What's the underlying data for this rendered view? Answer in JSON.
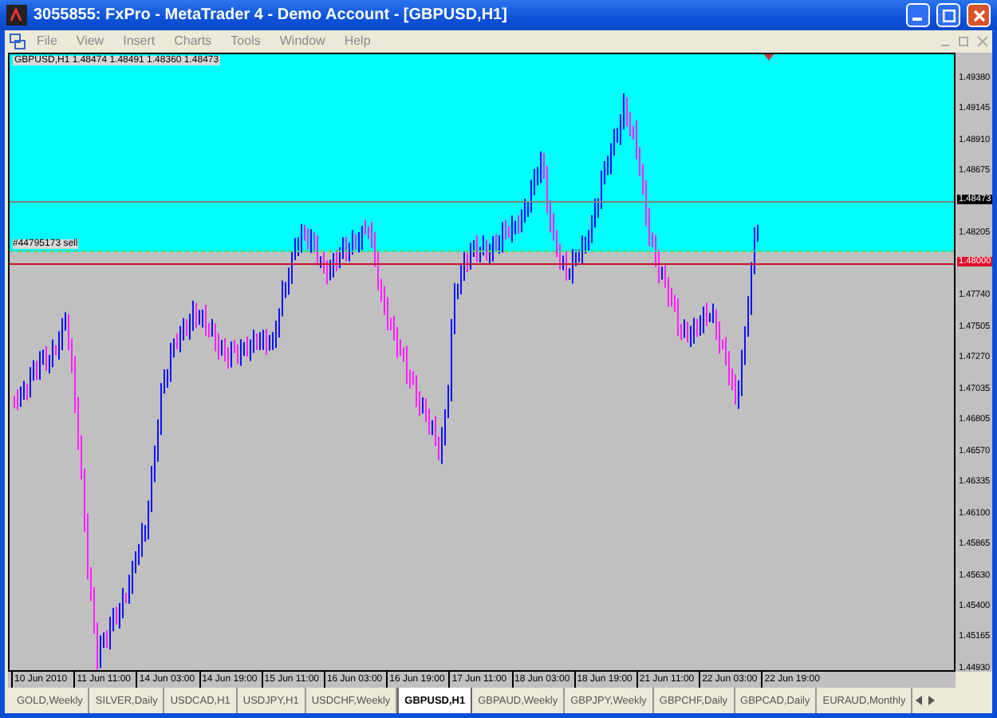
{
  "window": {
    "title": "3055855: FxPro - MetaTrader 4 - Demo Account - [GBPUSD,H1]"
  },
  "menu": [
    "File",
    "View",
    "Insert",
    "Charts",
    "Tools",
    "Window",
    "Help"
  ],
  "chart": {
    "header": "GBPUSD,H1  1.48474 1.48491 1.48360 1.48473",
    "order_line": {
      "label": "#44795173 sell"
    },
    "price_ticks": [
      "1.49380",
      "1.49145",
      "1.48910",
      "1.48675",
      "1.48205",
      "1.47740",
      "1.47505",
      "1.47270",
      "1.47035",
      "1.46805",
      "1.46570",
      "1.46335",
      "1.46100",
      "1.45865",
      "1.45630",
      "1.45400",
      "1.45165",
      "1.44930"
    ],
    "price_markers": [
      {
        "kind": "bid",
        "label": "1.48473"
      },
      {
        "kind": "alert",
        "label": "1.48000"
      }
    ],
    "time_ticks": [
      "10 Jun 2010",
      "11 Jun 11:00",
      "14 Jun 03:00",
      "14 Jun 19:00",
      "15 Jun 11:00",
      "16 Jun 03:00",
      "16 Jun 19:00",
      "17 Jun 11:00",
      "18 Jun 03:00",
      "18 Jun 19:00",
      "21 Jun 11:00",
      "22 Jun 03:00",
      "22 Jun 19:00"
    ]
  },
  "tabs": [
    {
      "label": "GOLD,Weekly",
      "selected": false
    },
    {
      "label": "SILVER,Daily",
      "selected": false
    },
    {
      "label": "USDCAD,H1",
      "selected": false
    },
    {
      "label": "USDJPY,H1",
      "selected": false
    },
    {
      "label": "USDCHF,Weekly",
      "selected": false
    },
    {
      "label": "GBPUSD,H1",
      "selected": true
    },
    {
      "label": "GBPAUD,Weekly",
      "selected": false
    },
    {
      "label": "GBPJPY,Weekly",
      "selected": false
    },
    {
      "label": "GBPCHF,Daily",
      "selected": false
    },
    {
      "label": "GBPCAD,Daily",
      "selected": false
    },
    {
      "label": "EURAUD,Monthly",
      "selected": false
    }
  ]
}
